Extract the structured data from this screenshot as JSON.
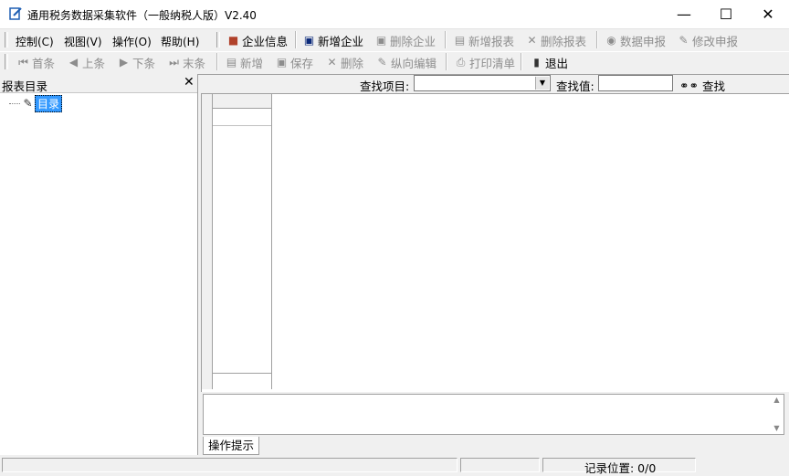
{
  "window": {
    "title": "通用税务数据采集软件（一般纳税人版）V2.40",
    "minimize": "—",
    "maximize": "☐",
    "close": "✕"
  },
  "menu": [
    {
      "label": "控制(C)"
    },
    {
      "label": "视图(V)"
    },
    {
      "label": "操作(O)"
    },
    {
      "label": "帮助(H)"
    }
  ],
  "toolbar1": {
    "company_info": "企业信息",
    "new_company": "新增企业",
    "delete_company": "删除企业",
    "new_report": "新增报表",
    "delete_report": "删除报表",
    "data_declare": "数据申报",
    "modify_declare": "修改申报"
  },
  "toolbar2": {
    "first": "首条",
    "prev": "上条",
    "next": "下条",
    "last": "末条",
    "add": "新增",
    "save": "保存",
    "delete": "删除",
    "vertical_edit": "纵向编辑",
    "print_list": "打印清单",
    "exit": "退出"
  },
  "left_panel": {
    "title": "报表目录",
    "close": "✕",
    "tree_root": "目录"
  },
  "search": {
    "item_label": "查找项目:",
    "item_value": "",
    "value_label": "查找值:",
    "value": "",
    "button": "查找"
  },
  "message": {
    "tab": "操作提示",
    "text": ""
  },
  "status": {
    "record_position": "记录位置: 0/0"
  }
}
